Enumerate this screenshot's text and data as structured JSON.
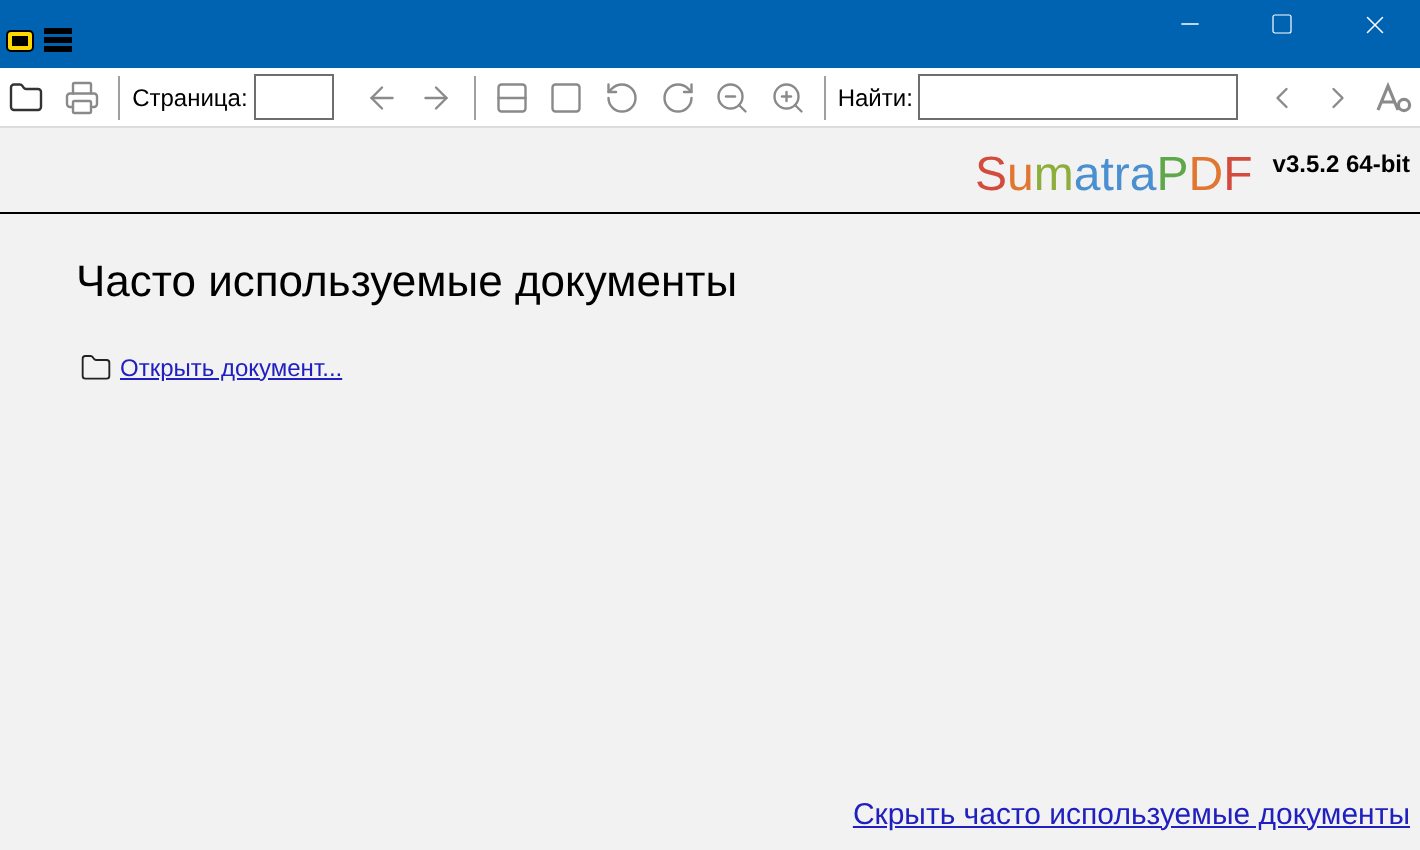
{
  "toolbar": {
    "page_label": "Страница:",
    "find_label": "Найти:"
  },
  "logo": {
    "letters": [
      {
        "text": "S",
        "color": "#d24b3c"
      },
      {
        "text": "u",
        "color": "#e0762f"
      },
      {
        "text": "m",
        "color": "#8cae3c"
      },
      {
        "text": "a",
        "color": "#4a8fd0"
      },
      {
        "text": "t",
        "color": "#4a8fd0"
      },
      {
        "text": "r",
        "color": "#4a8fd0"
      },
      {
        "text": "a",
        "color": "#4a8fd0"
      },
      {
        "text": "P",
        "color": "#5ea84a"
      },
      {
        "text": "D",
        "color": "#e0762f"
      },
      {
        "text": "F",
        "color": "#d24b3c"
      }
    ],
    "version": "v3.5.2 64-bit"
  },
  "heading": "Часто используемые документы",
  "open_link": "Открыть документ...",
  "hide_link": "Скрыть часто используемые документы"
}
